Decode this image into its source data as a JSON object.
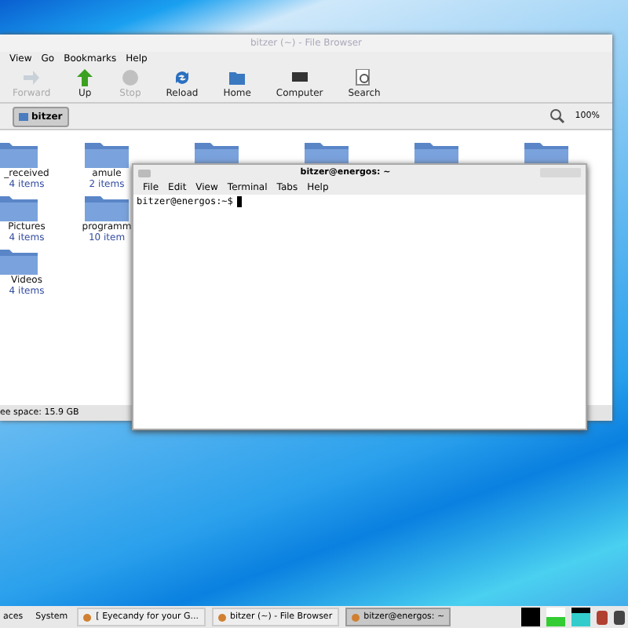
{
  "file_browser": {
    "title": "bitzer (~) - File Browser",
    "menu": [
      "View",
      "Go",
      "Bookmarks",
      "Help"
    ],
    "toolbar": [
      {
        "label": "Forward",
        "kind": "forward",
        "disabled": true
      },
      {
        "label": "Up",
        "kind": "up",
        "disabled": false
      },
      {
        "label": "Stop",
        "kind": "stop",
        "disabled": true
      },
      {
        "label": "Reload",
        "kind": "reload",
        "disabled": false
      },
      {
        "label": "Home",
        "kind": "home",
        "disabled": false
      },
      {
        "label": "Computer",
        "kind": "computer",
        "disabled": false
      },
      {
        "label": "Search",
        "kind": "search",
        "disabled": false
      }
    ],
    "path_button": "bitzer",
    "zoom": "100%",
    "folders": [
      {
        "name": "_received",
        "count": "4 items"
      },
      {
        "name": "amule",
        "count": "2 items"
      },
      {
        "name": "Pictures",
        "count": "4 items"
      },
      {
        "name": "programm",
        "count": "10 item"
      },
      {
        "name": "Videos",
        "count": "4 items"
      }
    ],
    "status": "ee space: 15.9 GB"
  },
  "terminal": {
    "title": "bitzer@energos: ~",
    "menu": [
      "File",
      "Edit",
      "View",
      "Terminal",
      "Tabs",
      "Help"
    ],
    "prompt": "bitzer@energos:~$"
  },
  "taskbar": {
    "menus": [
      "aces",
      "System"
    ],
    "tasks": [
      {
        "label": "[ Eyecandy for your G...",
        "selected": false
      },
      {
        "label": "bitzer (~) - File Browser",
        "selected": false
      },
      {
        "label": "bitzer@energos: ~",
        "selected": true
      }
    ]
  }
}
